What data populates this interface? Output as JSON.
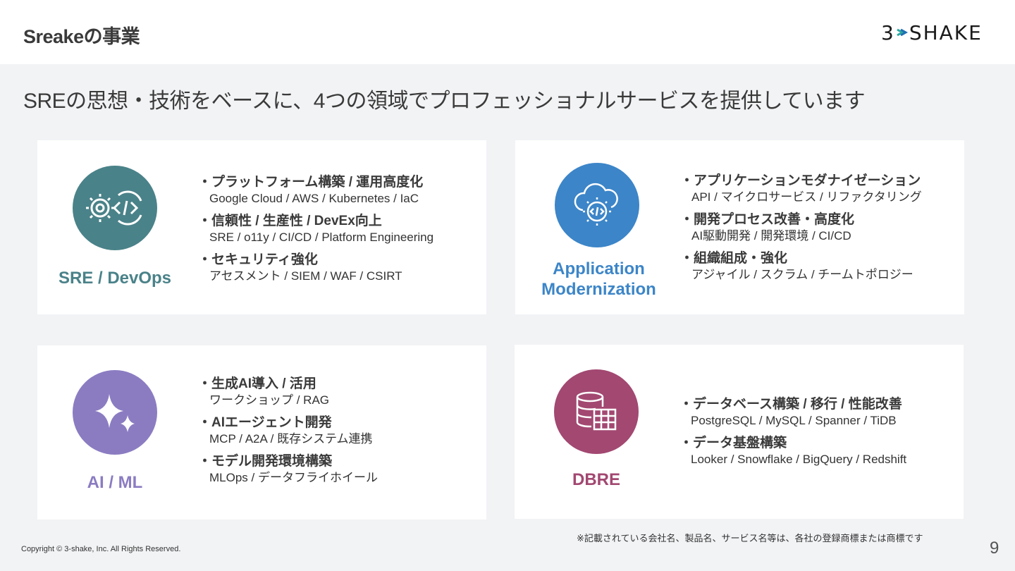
{
  "header": {
    "title": "Sreakeの事業",
    "logo_text": "3SHAKE"
  },
  "subtitle": "SREの思想・技術をベースに、4つの領域でプロフェッショナルサービスを提供しています",
  "cards": [
    {
      "label_line1": "SRE / DevOps",
      "label_line2": "",
      "color": "#4a8289",
      "icon": "gear-code-cycle-icon",
      "items": [
        {
          "title": "・プラットフォーム構築 / 運用高度化",
          "desc": "Google Cloud / AWS / Kubernetes / IaC"
        },
        {
          "title": "・信頼性 / 生産性 / DevEx向上",
          "desc": "SRE / o11y / CI/CD / Platform Engineering"
        },
        {
          "title": "・セキュリティ強化",
          "desc": "アセスメント / SIEM / WAF / CSIRT"
        }
      ]
    },
    {
      "label_line1": "Application",
      "label_line2": "Modernization",
      "color": "#3c85c8",
      "icon": "cloud-gear-code-icon",
      "items": [
        {
          "title": "・アプリケーションモダナイゼーション",
          "desc": "API / マイクロサービス / リファクタリング"
        },
        {
          "title": "・開発プロセス改善・高度化",
          "desc": "AI駆動開発 / 開発環境 / CI/CD"
        },
        {
          "title": "・組織組成・強化",
          "desc": "アジャイル / スクラム / チームトポロジー"
        }
      ]
    },
    {
      "label_line1": "AI / ML",
      "label_line2": "",
      "color": "#8b7cc2",
      "icon": "sparkle-icon",
      "items": [
        {
          "title": "・生成AI導入 / 活用",
          "desc": "ワークショップ / RAG"
        },
        {
          "title": "・AIエージェント開発",
          "desc": "MCP / A2A / 既存システム連携"
        },
        {
          "title": "・モデル開発環境構築",
          "desc": "MLOps / データフライホイール"
        }
      ]
    },
    {
      "label_line1": "DBRE",
      "label_line2": "",
      "color": "#a24871",
      "icon": "database-table-icon",
      "items": [
        {
          "title": "・データベース構築 / 移行 / 性能改善",
          "desc": "PostgreSQL / MySQL / Spanner / TiDB"
        },
        {
          "title": "・データ基盤構築",
          "desc": "Looker / Snowflake / BigQuery / Redshift"
        }
      ]
    }
  ],
  "footer": {
    "copyright": "Copyright © 3-shake, Inc. All Rights Reserved.",
    "note": "※記載されている会社名、製品名、サービス名等は、各社の登録商標または商標です",
    "page_number": "9"
  }
}
